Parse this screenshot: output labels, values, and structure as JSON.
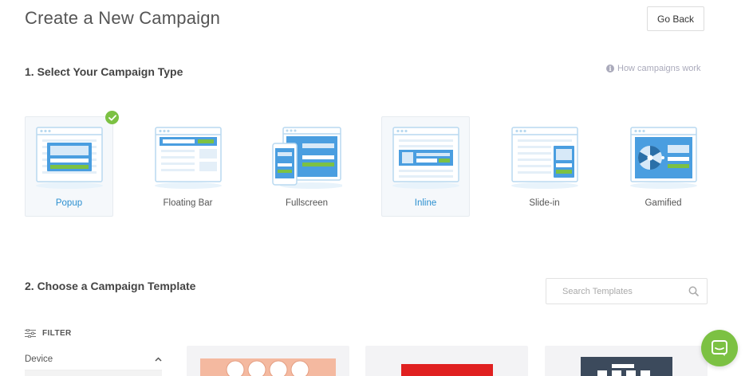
{
  "header": {
    "title": "Create a New Campaign",
    "go_back_label": "Go Back"
  },
  "section1": {
    "title": "1. Select Your Campaign Type",
    "how_link": "How campaigns work"
  },
  "campaign_types": [
    {
      "label": "Popup",
      "icon": "popup-illustration",
      "selected": true
    },
    {
      "label": "Floating Bar",
      "icon": "floating-bar-illustration",
      "selected": false
    },
    {
      "label": "Fullscreen",
      "icon": "fullscreen-illustration",
      "selected": false
    },
    {
      "label": "Inline",
      "icon": "inline-illustration",
      "selected": false,
      "highlighted": true
    },
    {
      "label": "Slide-in",
      "icon": "slide-in-illustration",
      "selected": false
    },
    {
      "label": "Gamified",
      "icon": "gamified-illustration",
      "selected": false
    }
  ],
  "section2": {
    "title": "2. Choose a Campaign Template"
  },
  "search": {
    "placeholder": "Search Templates",
    "value": ""
  },
  "filter": {
    "label": "FILTER",
    "device_label": "Device"
  },
  "colors": {
    "accent_blue": "#2b8fd0",
    "illustration_blue": "#4a9ee0",
    "green": "#7cc143",
    "light_blue": "#e8f3fb"
  }
}
